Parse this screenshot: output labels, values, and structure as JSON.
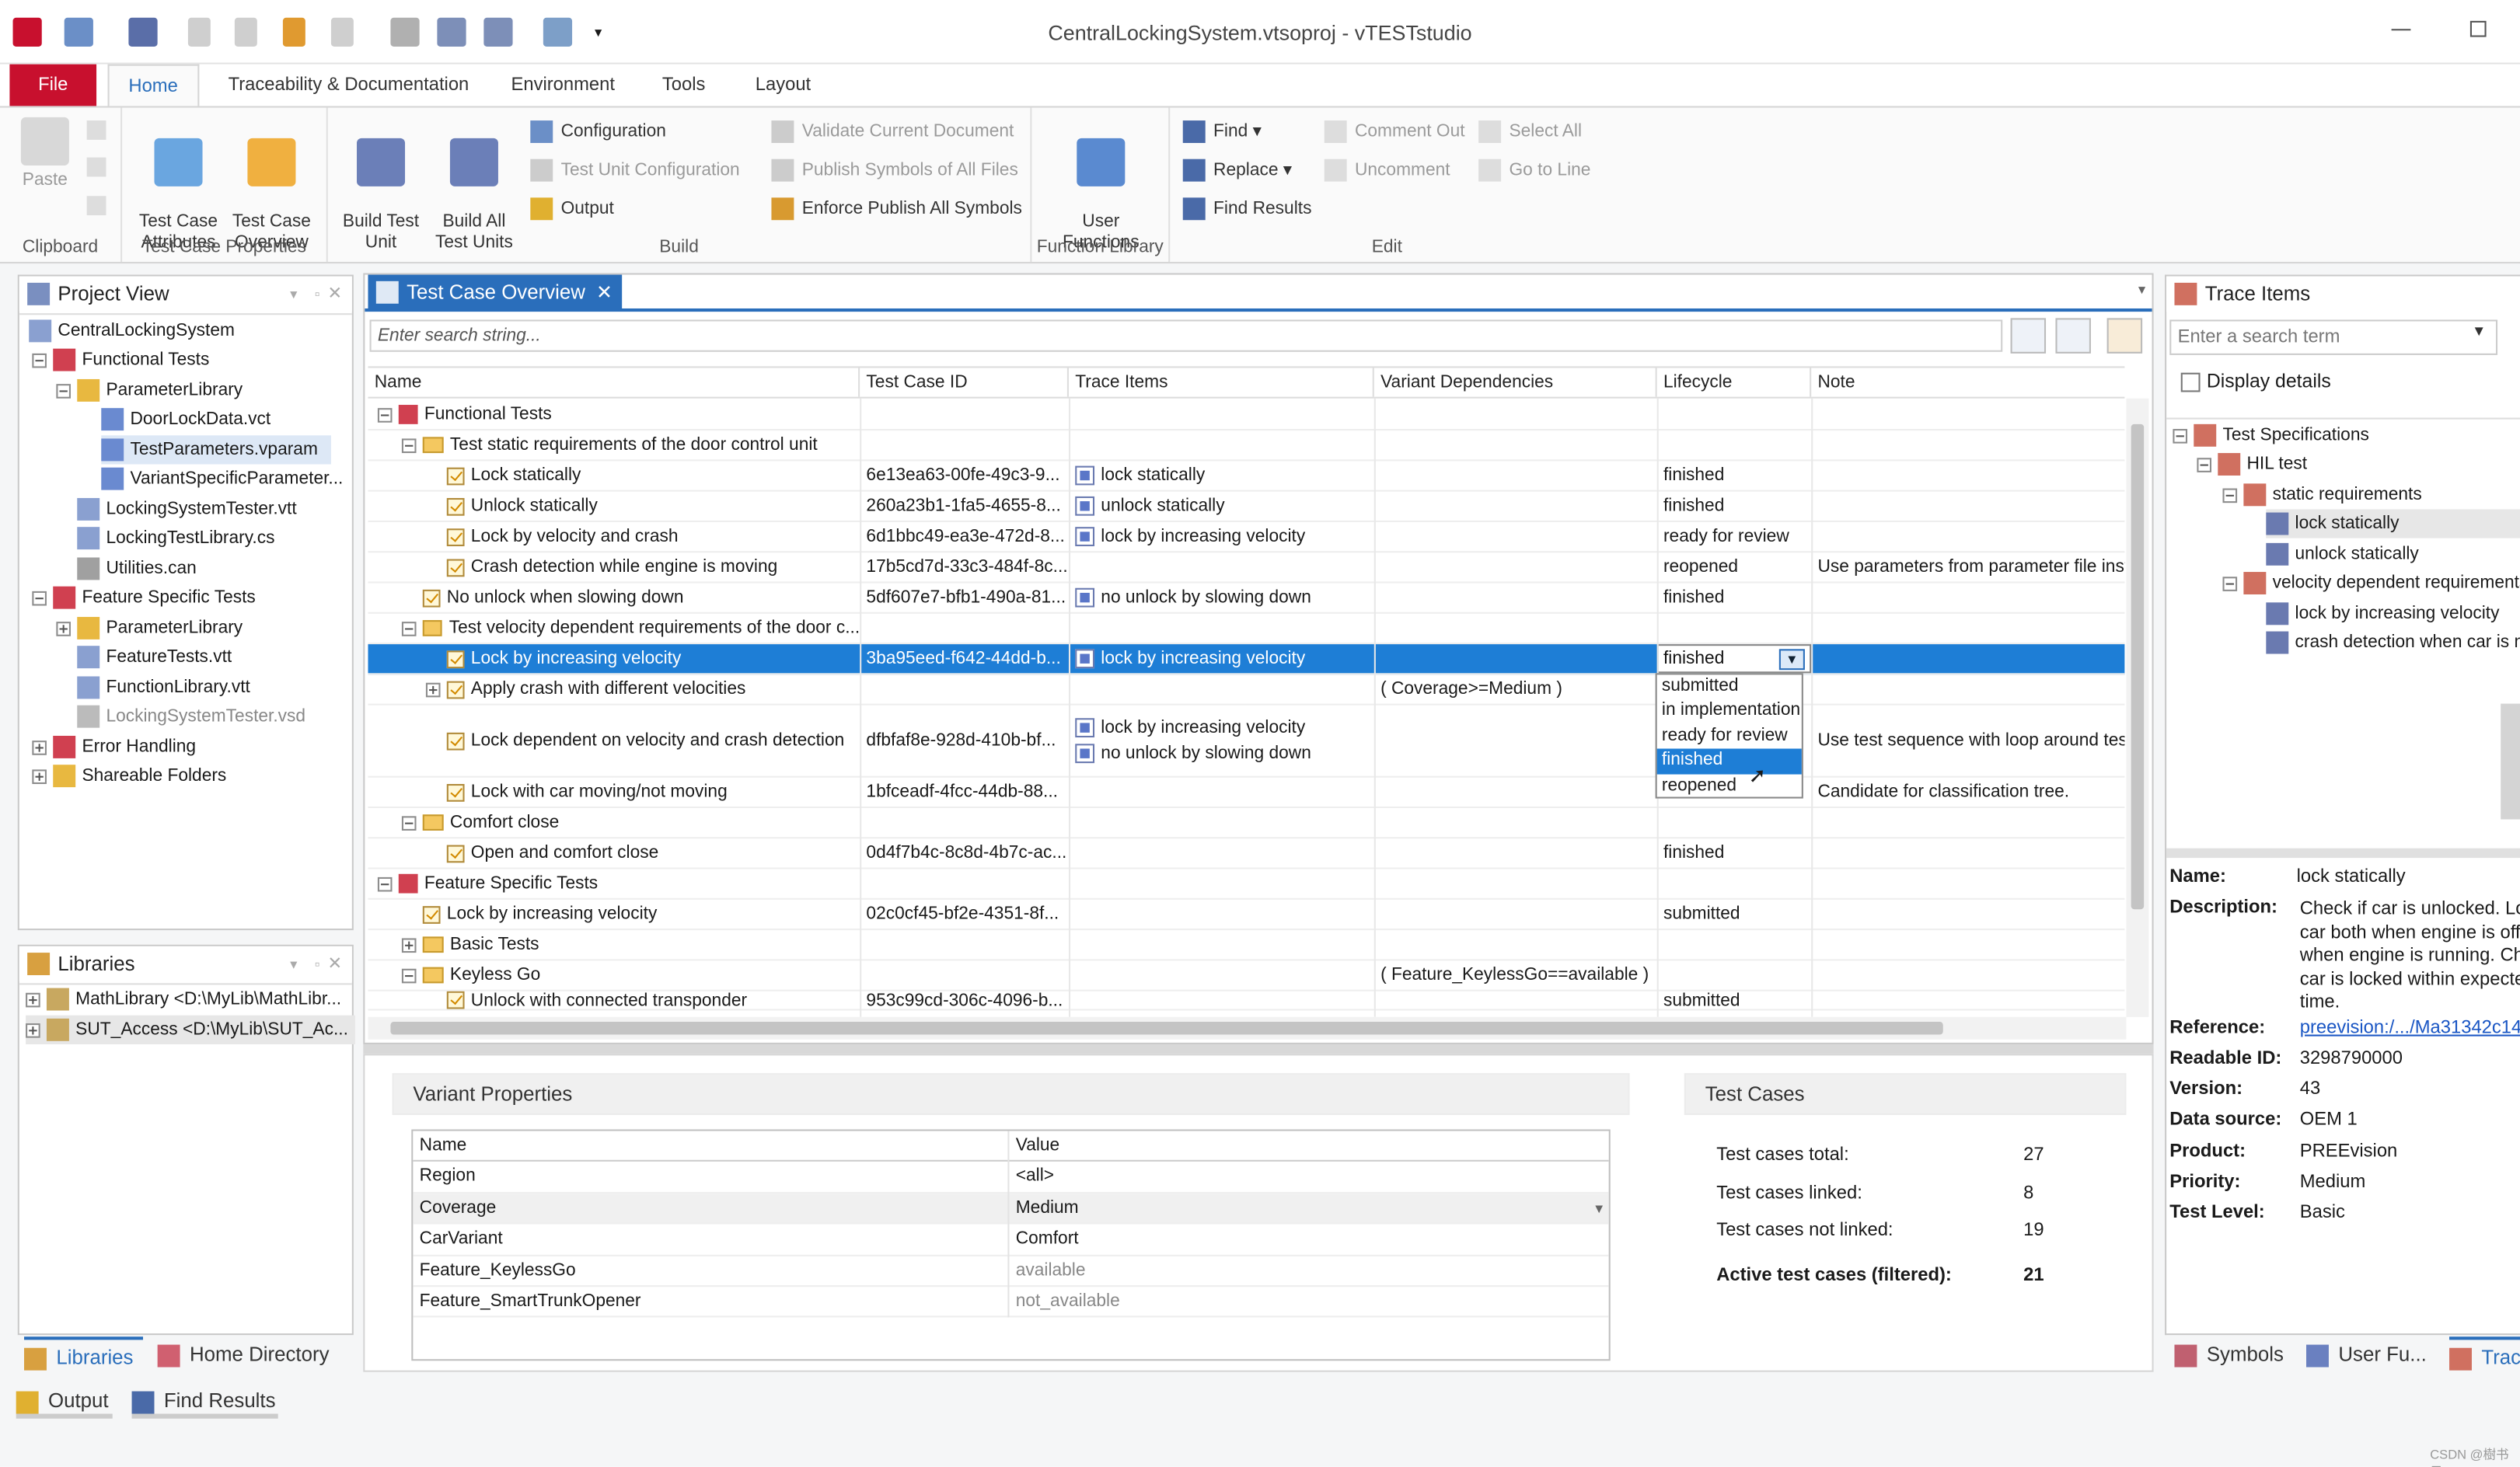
{
  "window": {
    "title": "CentralLockingSystem.vtsoproj - vTESTstudio"
  },
  "ribbon_tabs": [
    "File",
    "Home",
    "Traceability & Documentation",
    "Environment",
    "Tools",
    "Layout"
  ],
  "ribbon": {
    "clipboard": {
      "paste": "Paste",
      "label": "Clipboard"
    },
    "test_case_properties": {
      "attributes": "Test Case\nAttributes",
      "overview": "Test Case\nOverview",
      "label": "Test Case Properties"
    },
    "build": {
      "build_test_unit": "Build Test\nUnit",
      "build_all": "Build All\nTest Units",
      "configuration": "Configuration",
      "test_unit_configuration": "Test Unit Configuration",
      "output": "Output",
      "label": "Build"
    },
    "validate": {
      "validate_current": "Validate Current Document",
      "publish_symbols": "Publish Symbols of All Files",
      "enforce_publish": "Enforce Publish All Symbols"
    },
    "function_library": {
      "user_functions": "User\nFunctions",
      "label": "Function Library"
    },
    "edit": {
      "find": "Find",
      "replace": "Replace",
      "find_results": "Find Results",
      "comment_out": "Comment Out",
      "uncomment": "Uncomment",
      "select_all": "Select All",
      "go_to_line": "Go to Line",
      "label": "Edit"
    }
  },
  "project_view": {
    "title": "Project View",
    "items": [
      "CentralLockingSystem",
      "Functional Tests",
      "ParameterLibrary",
      "DoorLockData.vct",
      "TestParameters.vparam",
      "VariantSpecificParameter...",
      "LockingSystemTester.vtt",
      "LockingTestLibrary.cs",
      "Utilities.can",
      "Feature Specific Tests",
      "ParameterLibrary",
      "FeatureTests.vtt",
      "FunctionLibrary.vtt",
      "LockingSystemTester.vsd",
      "Error Handling",
      "Shareable Folders"
    ]
  },
  "libraries": {
    "title": "Libraries",
    "items": [
      "MathLibrary <D:\\MyLib\\MathLibr...",
      "SUT_Access <D:\\MyLib\\SUT_Ac..."
    ]
  },
  "left_bottom_tabs": {
    "libraries": "Libraries",
    "home_directory": "Home Directory"
  },
  "output_tabs": {
    "output": "Output",
    "find_results": "Find Results"
  },
  "overview": {
    "tab": "Test Case Overview",
    "search_placeholder": "Enter search string...",
    "columns": [
      "Name",
      "Test Case ID",
      "Trace Items",
      "Variant Dependencies",
      "Lifecycle",
      "Note"
    ],
    "rows": [
      {
        "name": "Functional Tests",
        "id": "",
        "trace": "",
        "variant": "",
        "lifecycle": "",
        "note": ""
      },
      {
        "name": "Test static requirements of the door control unit",
        "id": "",
        "trace": "",
        "variant": "",
        "lifecycle": "",
        "note": ""
      },
      {
        "name": "Lock statically",
        "id": "6e13ea63-00fe-49c3-9...",
        "trace": "lock statically",
        "variant": "",
        "lifecycle": "finished",
        "note": ""
      },
      {
        "name": "Unlock statically",
        "id": "260a23b1-1fa5-4655-8...",
        "trace": "unlock statically",
        "variant": "",
        "lifecycle": "finished",
        "note": ""
      },
      {
        "name": "Lock by velocity and crash",
        "id": "6d1bbc49-ea3e-472d-8...",
        "trace": "lock by increasing velocity",
        "variant": "",
        "lifecycle": "ready for review",
        "note": ""
      },
      {
        "name": "Crash detection while engine is moving",
        "id": "17b5cd7d-33c3-484f-8c...",
        "trace": "",
        "variant": "",
        "lifecycle": "reopened",
        "note": "Use parameters from parameter file inst"
      },
      {
        "name": "No unlock when slowing down",
        "id": "5df607e7-bfb1-490a-81...",
        "trace": "no unlock by slowing down",
        "variant": "",
        "lifecycle": "finished",
        "note": ""
      },
      {
        "name": "Test velocity dependent requirements of the door c...",
        "id": "",
        "trace": "",
        "variant": "",
        "lifecycle": "",
        "note": ""
      },
      {
        "name": "Lock by increasing velocity",
        "id": "3ba95eed-f642-44dd-b...",
        "trace": "lock by increasing velocity",
        "variant": "",
        "lifecycle": "finished",
        "note": ""
      },
      {
        "name": "Apply crash with different velocities",
        "id": "",
        "trace": "",
        "variant": "( Coverage>=Medium )",
        "lifecycle": "",
        "note": ""
      },
      {
        "name": "Lock dependent on velocity and crash detection",
        "id": "dfbfaf8e-928d-410b-bf...",
        "trace": "lock by increasing velocity",
        "trace2": "no unlock by slowing down",
        "variant": "",
        "lifecycle": "",
        "note": "Use test sequence with loop around test"
      },
      {
        "name": "Lock with car moving/not moving",
        "id": "1bfceadf-4fcc-44db-88...",
        "trace": "",
        "variant": "",
        "lifecycle": "",
        "note": "Candidate for classification tree."
      },
      {
        "name": "Comfort close",
        "id": "",
        "trace": "",
        "variant": "",
        "lifecycle": "",
        "note": ""
      },
      {
        "name": "Open and comfort close",
        "id": "0d4f7b4c-8c8d-4b7c-ac...",
        "trace": "",
        "variant": "",
        "lifecycle": "finished",
        "note": ""
      },
      {
        "name": "Feature Specific Tests",
        "id": "",
        "trace": "",
        "variant": "",
        "lifecycle": "",
        "note": ""
      },
      {
        "name": "Lock by increasing velocity",
        "id": "02c0cf45-bf2e-4351-8f...",
        "trace": "",
        "variant": "",
        "lifecycle": "submitted",
        "note": ""
      },
      {
        "name": "Basic Tests",
        "id": "",
        "trace": "",
        "variant": "",
        "lifecycle": "",
        "note": ""
      },
      {
        "name": "Keyless Go",
        "id": "",
        "trace": "",
        "variant": "( Feature_KeylessGo==available )",
        "lifecycle": "",
        "note": ""
      },
      {
        "name": "Unlock with connected transponder",
        "id": "953c99cd-306c-4096-b...",
        "trace": "",
        "variant": "",
        "lifecycle": "submitted",
        "note": ""
      }
    ],
    "lifecycle_options": [
      "submitted",
      "in implementation",
      "ready for review",
      "finished",
      "reopened"
    ]
  },
  "variant_properties": {
    "title": "Variant Properties",
    "columns": [
      "Name",
      "Value"
    ],
    "rows": [
      [
        "Region",
        "<all>"
      ],
      [
        "Coverage",
        "Medium"
      ],
      [
        "CarVariant",
        "Comfort"
      ],
      [
        "Feature_KeylessGo",
        "available"
      ],
      [
        "Feature_SmartTrunkOpener",
        "not_available"
      ]
    ]
  },
  "test_cases": {
    "title": "Test Cases",
    "total_label": "Test cases total:",
    "total": "27",
    "linked_label": "Test cases linked:",
    "linked": "8",
    "not_linked_label": "Test cases not linked:",
    "not_linked": "19",
    "active_label": "Active test cases (filtered):",
    "active": "21"
  },
  "trace_items": {
    "title": "Trace Items",
    "search_placeholder": "Enter a search term",
    "display_details": "Display details",
    "tree": [
      "Test Specifications",
      "HIL test",
      "static requirements",
      "lock statically",
      "unlock statically",
      "velocity dependent requirements",
      "lock by increasing velocity",
      "crash detection when car is m"
    ],
    "details": {
      "name_label": "Name:",
      "name": "lock statically",
      "description_label": "Description:",
      "description": [
        "Check if car is unlocked. Lo",
        "car both when engine is off",
        "when engine is running. Ch",
        "car is locked within expecte",
        "time."
      ],
      "reference_label": "Reference:",
      "reference": "preevision:/.../Ma31342c14",
      "readable_id_label": "Readable ID:",
      "readable_id": "3298790000",
      "version_label": "Version:",
      "version": "43",
      "data_source_label": "Data source:",
      "data_source": "OEM 1",
      "product_label": "Product:",
      "product": "PREEvision",
      "priority_label": "Priority:",
      "priority": "Medium",
      "test_level_label": "Test Level:",
      "test_level": "Basic"
    },
    "bottom_tabs": [
      "Symbols",
      "User Fu...",
      "Trac"
    ]
  },
  "watermark": "CSDN @樹书予",
  "colors": {
    "accent": "#2a6ebb",
    "selection": "#1e7ed6",
    "file_tab": "#c8102e",
    "link": "#1a56c4"
  }
}
